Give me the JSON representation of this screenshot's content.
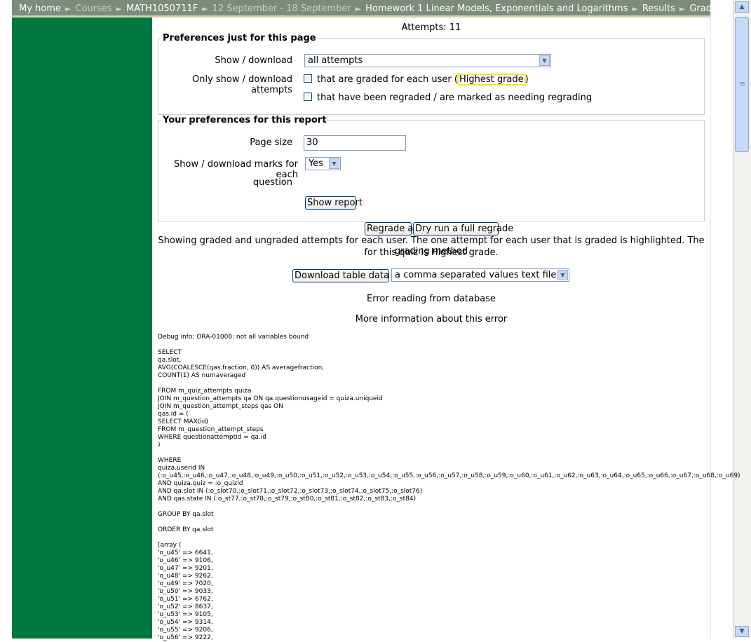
{
  "breadcrumb": [
    {
      "label": "My home",
      "dim": false
    },
    {
      "label": "Courses",
      "dim": true
    },
    {
      "label": "MATH1050711F",
      "dim": false
    },
    {
      "label": "12 September - 18 September",
      "dim": true
    },
    {
      "label": "Homework 1 Linear Models, Exponentials and Logarithms",
      "dim": false
    },
    {
      "label": "Results",
      "dim": false
    },
    {
      "label": "Grades",
      "dim": false
    }
  ],
  "separator": "►",
  "attempts_text": "Attempts: 11",
  "prefs_page": {
    "legend": "Preferences just for this page",
    "show_download_label": "Show / download",
    "show_download_value": "all attempts",
    "only_show_label": "Only show / download attempts",
    "graded_prefix": "that are graded for each user (",
    "graded_highlight": "Highest grade",
    "graded_suffix": ")",
    "regraded_label": "that have been regraded / are marked as needing regrading"
  },
  "prefs_report": {
    "legend": "Your preferences for this report",
    "page_size_label": "Page size",
    "page_size_value": "30",
    "marks_label_line1": "Show / download marks for each",
    "marks_label_line2": "question",
    "marks_value": "Yes",
    "show_report_button": "Show report"
  },
  "regrade_all_button": "Regrade all",
  "dry_run_button": "Dry run a full regrade",
  "info_line1": "Showing graded and ungraded attempts for each user. The one attempt for each user that is graded is highlighted. The grading method",
  "info_line2": "for this quiz is Highest grade.",
  "download_button": "Download table data as",
  "download_format": "a comma separated values text file",
  "error_text": "Error reading from database",
  "more_info_text": "More information about this error",
  "debug_text": "Debug info: ORA-01008: not all variables bound\n\nSELECT\nqa.slot,\nAVG(COALESCE(qas.fraction, 0)) AS averagefraction,\nCOUNT(1) AS numaveraged\n\nFROM m_quiz_attempts quiza\nJOIN m_question_attempts qa ON qa.questionusageid = quiza.uniqueid\nJOIN m_question_attempt_steps qas ON\nqas.id = (\nSELECT MAX(id)\nFROM m_question_attempt_steps\nWHERE questionattemptid = qa.id\n)\n\nWHERE\nquiza.userid IN\n(:o_u45,:o_u46,:o_u47,:o_u48,:o_u49,:o_u50,:o_u51,:o_u52,:o_u53,:o_u54,:o_u55,:o_u56,:o_u57,:o_u58,:o_u59,:o_u60,:o_u61,:o_u62,:o_u63,:o_u64,:o_u65,:o_u66,:o_u67,:o_u68,:o_u69)\nAND quiza.quiz = :o_quizid\nAND qa.slot IN (:o_slot70,:o_slot71,:o_slot72,:o_slot73,:o_slot74,:o_slot75,:o_slot76)\nAND qas.state IN (:o_st77,:o_st78,:o_st79,:o_st80,:o_st81,:o_st82,:o_st83,:o_st84)\n\nGROUP BY qa.slot\n\nORDER BY qa.slot\n\n[array (\n'o_u45' => 6641,\n'o_u46' => 9106,\n'o_u47' => 9201,\n'o_u48' => 9262,\n'o_u49' => 7020,\n'o_u50' => 9033,\n'o_u51' => 6762,\n'o_u52' => 8637,\n'o_u53' => 9105,\n'o_u54' => 9314,\n'o_u55' => 9206,\n'o_u56' => 9222,"
}
